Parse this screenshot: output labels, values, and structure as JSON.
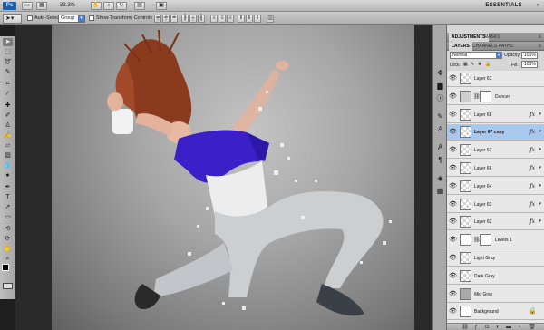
{
  "app": {
    "logo": "Ps",
    "zoom": "33.3%",
    "workspace": "ESSENTIALS",
    "icons": [
      "launch-bridge-icon",
      "view-extras-icon",
      "hand-icon",
      "zoom-icon",
      "rotate-view-icon",
      "arrange-documents-icon",
      "screen-mode-icon"
    ]
  },
  "options": {
    "auto_select_label": "Auto-Select:",
    "auto_select_value": "Group",
    "show_transform_label": "Show Transform Controls"
  },
  "tools": [
    "move",
    "marquee",
    "lasso",
    "quick-select",
    "crop",
    "eyedropper",
    "healing-brush",
    "brush",
    "clone-stamp",
    "history-brush",
    "eraser",
    "gradient",
    "blur",
    "dodge",
    "pen",
    "type",
    "path-selection",
    "shape",
    "3d-rotate",
    "3d-orbit",
    "hand",
    "zoom"
  ],
  "panel_tabs_top": {
    "adjustments": "ADJUSTMENTS",
    "masks": "MASKS"
  },
  "panel_tabs_layers": {
    "layers": "LAYERS",
    "channels": "CHANNELS",
    "paths": "PATHS"
  },
  "layers_panel": {
    "blend_mode": "Normal",
    "opacity_label": "Opacity:",
    "opacity_value": "100%",
    "lock_label": "Lock:",
    "fill_label": "Fill:",
    "fill_value": "100%"
  },
  "layers": [
    {
      "name": "Layer 61",
      "thumb": "checker",
      "fx": false
    },
    {
      "name": "Dancer",
      "thumb": "dancer",
      "fx": false,
      "mask": true
    },
    {
      "name": "Layer 68",
      "thumb": "checker",
      "fx": true
    },
    {
      "name": "Layer 67 copy",
      "thumb": "checker",
      "fx": true,
      "selected": true
    },
    {
      "name": "Layer 67",
      "thumb": "checker",
      "fx": true
    },
    {
      "name": "Layer 66",
      "thumb": "checker",
      "fx": true
    },
    {
      "name": "Layer 64",
      "thumb": "checker",
      "fx": true
    },
    {
      "name": "Layer 63",
      "thumb": "checker",
      "fx": true
    },
    {
      "name": "Layer 62",
      "thumb": "checker",
      "fx": true
    },
    {
      "name": "Levels 1",
      "thumb": "adj",
      "fx": false,
      "mask": true
    },
    {
      "name": "Light Gray",
      "thumb": "checker",
      "fx": false
    },
    {
      "name": "Dark Gray",
      "thumb": "checker",
      "fx": false
    },
    {
      "name": "Mid Gray",
      "thumb": "solid-mid",
      "fx": false
    },
    {
      "name": "Background",
      "thumb": "white",
      "fx": false,
      "locked": true
    }
  ],
  "colors": {
    "accent": "#4b7bc5",
    "selected_layer": "#a8c8ee",
    "shirt": "#3b20c9"
  }
}
